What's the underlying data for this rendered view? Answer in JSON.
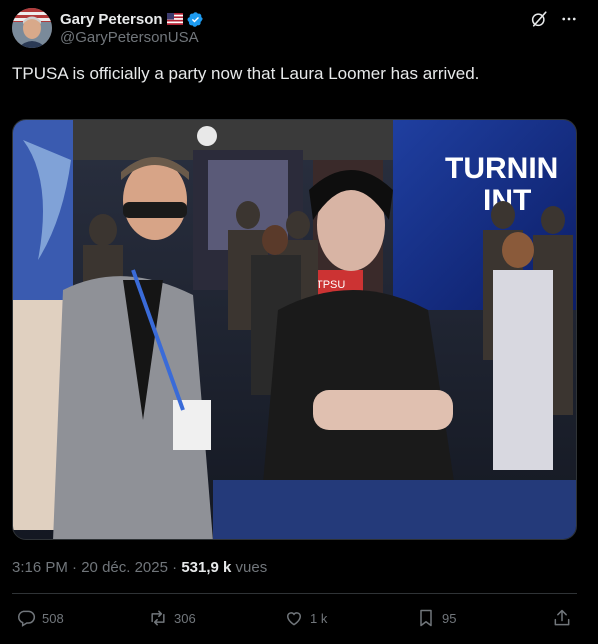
{
  "author": {
    "name": "Gary Peterson",
    "handle": "@GaryPetersonUSA",
    "flag_icon": "us-flag-icon",
    "verified_icon": "verified-badge-icon"
  },
  "post": {
    "text": "TPUSA is officially a party now that Laura Loomer has arrived."
  },
  "media": {
    "sign_text_line1": "TURNIN",
    "sign_text_line2": "INT",
    "booth_text": "TPSU"
  },
  "meta": {
    "time": "3:16 PM",
    "separator1": " · ",
    "date": "20 déc. 2025",
    "separator2": " · ",
    "views_count": "531,9 k",
    "views_label": " vues"
  },
  "actions": {
    "replies": "508",
    "reposts": "306",
    "likes": "1 k",
    "bookmarks": "95"
  },
  "colors": {
    "background": "#000000",
    "text_primary": "#e7e9ea",
    "text_secondary": "#71767b",
    "verified_blue": "#1d9bf0",
    "divider": "#2f3336"
  }
}
